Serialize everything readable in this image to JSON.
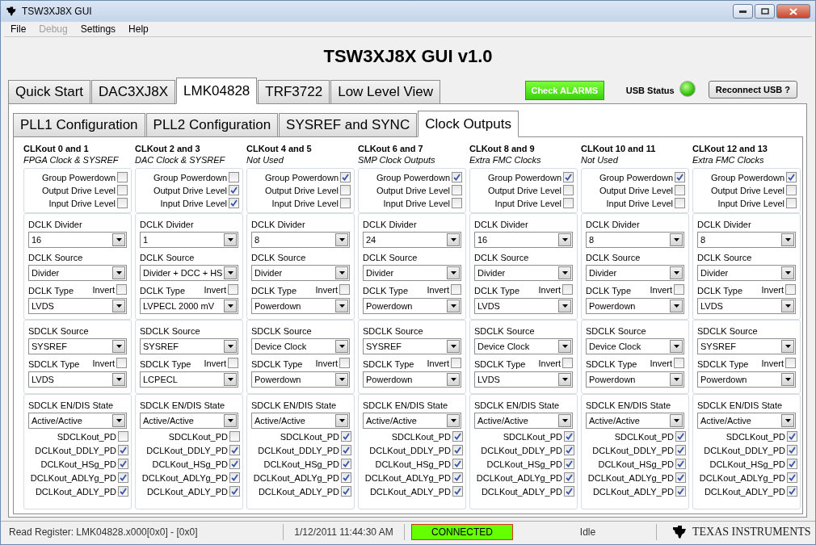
{
  "window": {
    "title": "TSW3XJ8X GUI"
  },
  "menu": [
    {
      "label": "File",
      "disabled": false
    },
    {
      "label": "Debug",
      "disabled": true
    },
    {
      "label": "Settings",
      "disabled": false
    },
    {
      "label": "Help",
      "disabled": false
    }
  ],
  "header": {
    "title": "TSW3XJ8X GUI v1.0"
  },
  "tabs": [
    {
      "label": "Quick Start",
      "selected": false
    },
    {
      "label": "DAC3XJ8X",
      "selected": false
    },
    {
      "label": "LMK04828",
      "selected": true
    },
    {
      "label": "TRF3722",
      "selected": false
    },
    {
      "label": "Low Level View",
      "selected": false
    }
  ],
  "alarm_button": "Check ALARMS",
  "usb_status": {
    "label": "USB Status",
    "on": true
  },
  "reconnect_button": "Reconnect USB ?",
  "subtabs": [
    {
      "label": "PLL1 Configuration",
      "selected": false
    },
    {
      "label": "PLL2 Configuration",
      "selected": false
    },
    {
      "label": "SYSREF and SYNC",
      "selected": false
    },
    {
      "label": "Clock Outputs",
      "selected": true
    }
  ],
  "columns": [
    {
      "title": "CLKout 0 and 1",
      "subtitle": "FPGA Clock & SYSREF",
      "groups": [
        {
          "items": [
            {
              "kind": "check",
              "label": "Group Powerdown",
              "checked": false
            },
            {
              "kind": "check",
              "label": "Output Drive Level",
              "checked": false
            },
            {
              "kind": "check",
              "label": "Input Drive Level",
              "checked": false
            }
          ]
        },
        {
          "items": [
            {
              "kind": "select",
              "label": "DCLK Divider",
              "value": "16"
            },
            {
              "kind": "select",
              "label": "DCLK Source",
              "value": "Divider"
            },
            {
              "kind": "select",
              "label": "DCLK Type",
              "value": "LVDS",
              "invert": {
                "label": "Invert",
                "checked": false
              }
            }
          ]
        },
        {
          "items": [
            {
              "kind": "select",
              "label": "SDCLK Source",
              "value": "SYSREF"
            },
            {
              "kind": "select",
              "label": "SDCLK Type",
              "value": "LVDS",
              "invert": {
                "label": "Invert",
                "checked": false
              }
            }
          ]
        },
        {
          "items": [
            {
              "kind": "select",
              "label": "SDCLK EN/DIS State",
              "value": "Active/Active"
            },
            {
              "kind": "check",
              "label": "SDCLKout_PD",
              "checked": false
            },
            {
              "kind": "check",
              "label": "DCLKout_DDLY_PD",
              "checked": true
            },
            {
              "kind": "check",
              "label": "DCLKout_HSg_PD",
              "checked": true
            },
            {
              "kind": "check",
              "label": "DCLKout_ADLYg_PD",
              "checked": true
            },
            {
              "kind": "check",
              "label": "DCLKout_ADLY_PD",
              "checked": true
            }
          ]
        }
      ]
    },
    {
      "title": "CLKout 2 and 3",
      "subtitle": "DAC Clock & SYSREF",
      "groups": [
        {
          "items": [
            {
              "kind": "check",
              "label": "Group Powerdown",
              "checked": false
            },
            {
              "kind": "check",
              "label": "Output Drive Level",
              "checked": true
            },
            {
              "kind": "check",
              "label": "Input Drive Level",
              "checked": true
            }
          ]
        },
        {
          "items": [
            {
              "kind": "select",
              "label": "DCLK Divider",
              "value": "1"
            },
            {
              "kind": "select",
              "label": "DCLK Source",
              "value": "Divider + DCC + HS"
            },
            {
              "kind": "select",
              "label": "DCLK Type",
              "value": "LVPECL 2000 mV",
              "invert": {
                "label": "Invert",
                "checked": false
              }
            }
          ]
        },
        {
          "items": [
            {
              "kind": "select",
              "label": "SDCLK Source",
              "value": "SYSREF"
            },
            {
              "kind": "select",
              "label": "SDCLK Type",
              "value": "LCPECL",
              "invert": {
                "label": "Invert",
                "checked": false
              }
            }
          ]
        },
        {
          "items": [
            {
              "kind": "select",
              "label": "SDCLK EN/DIS State",
              "value": "Active/Active"
            },
            {
              "kind": "check",
              "label": "SDCLKout_PD",
              "checked": false
            },
            {
              "kind": "check",
              "label": "DCLKout_DDLY_PD",
              "checked": true
            },
            {
              "kind": "check",
              "label": "DCLKout_HSg_PD",
              "checked": true
            },
            {
              "kind": "check",
              "label": "DCLKout_ADLYg_PD",
              "checked": true
            },
            {
              "kind": "check",
              "label": "DCLKout_ADLY_PD",
              "checked": true
            }
          ]
        }
      ]
    },
    {
      "title": "CLKout 4 and 5",
      "subtitle": "Not Used",
      "groups": [
        {
          "items": [
            {
              "kind": "check",
              "label": "Group Powerdown",
              "checked": true
            },
            {
              "kind": "check",
              "label": "Output Drive Level",
              "checked": false
            },
            {
              "kind": "check",
              "label": "Input Drive Level",
              "checked": false
            }
          ]
        },
        {
          "items": [
            {
              "kind": "select",
              "label": "DCLK Divider",
              "value": "8"
            },
            {
              "kind": "select",
              "label": "DCLK Source",
              "value": "Divider"
            },
            {
              "kind": "select",
              "label": "DCLK Type",
              "value": "Powerdown",
              "invert": {
                "label": "Invert",
                "checked": false
              }
            }
          ]
        },
        {
          "items": [
            {
              "kind": "select",
              "label": "SDCLK Source",
              "value": "Device Clock"
            },
            {
              "kind": "select",
              "label": "SDCLK Type",
              "value": "Powerdown",
              "invert": {
                "label": "Invert",
                "checked": false
              }
            }
          ]
        },
        {
          "items": [
            {
              "kind": "select",
              "label": "SDCLK EN/DIS State",
              "value": "Active/Active"
            },
            {
              "kind": "check",
              "label": "SDCLKout_PD",
              "checked": true
            },
            {
              "kind": "check",
              "label": "DCLKout_DDLY_PD",
              "checked": true
            },
            {
              "kind": "check",
              "label": "DCLKout_HSg_PD",
              "checked": true
            },
            {
              "kind": "check",
              "label": "DCLKout_ADLYg_PD",
              "checked": true
            },
            {
              "kind": "check",
              "label": "DCLKout_ADLY_PD",
              "checked": true
            }
          ]
        }
      ]
    },
    {
      "title": "CLKout 6 and 7",
      "subtitle": "SMP Clock Outputs",
      "groups": [
        {
          "items": [
            {
              "kind": "check",
              "label": "Group Powerdown",
              "checked": true
            },
            {
              "kind": "check",
              "label": "Output Drive Level",
              "checked": false
            },
            {
              "kind": "check",
              "label": "Input Drive Level",
              "checked": false
            }
          ]
        },
        {
          "items": [
            {
              "kind": "select",
              "label": "DCLK Divider",
              "value": "24"
            },
            {
              "kind": "select",
              "label": "DCLK Source",
              "value": "Divider"
            },
            {
              "kind": "select",
              "label": "DCLK Type",
              "value": "Powerdown",
              "invert": {
                "label": "Invert",
                "checked": false
              }
            }
          ]
        },
        {
          "items": [
            {
              "kind": "select",
              "label": "SDCLK Source",
              "value": "SYSREF"
            },
            {
              "kind": "select",
              "label": "SDCLK Type",
              "value": "Powerdown",
              "invert": {
                "label": "Invert",
                "checked": false
              }
            }
          ]
        },
        {
          "items": [
            {
              "kind": "select",
              "label": "SDCLK EN/DIS State",
              "value": "Active/Active"
            },
            {
              "kind": "check",
              "label": "SDCLKout_PD",
              "checked": true
            },
            {
              "kind": "check",
              "label": "DCLKout_DDLY_PD",
              "checked": true
            },
            {
              "kind": "check",
              "label": "DCLKout_HSg_PD",
              "checked": true
            },
            {
              "kind": "check",
              "label": "DCLKout_ADLYg_PD",
              "checked": true
            },
            {
              "kind": "check",
              "label": "DCLKout_ADLY_PD",
              "checked": true
            }
          ]
        }
      ]
    },
    {
      "title": "CLKout 8 and 9",
      "subtitle": "Extra FMC Clocks",
      "groups": [
        {
          "items": [
            {
              "kind": "check",
              "label": "Group Powerdown",
              "checked": true
            },
            {
              "kind": "check",
              "label": "Output Drive Level",
              "checked": false
            },
            {
              "kind": "check",
              "label": "Input Drive Level",
              "checked": false
            }
          ]
        },
        {
          "items": [
            {
              "kind": "select",
              "label": "DCLK Divider",
              "value": "16"
            },
            {
              "kind": "select",
              "label": "DCLK Source",
              "value": "Divider"
            },
            {
              "kind": "select",
              "label": "DCLK Type",
              "value": "LVDS",
              "invert": {
                "label": "Invert",
                "checked": false
              }
            }
          ]
        },
        {
          "items": [
            {
              "kind": "select",
              "label": "SDCLK Source",
              "value": "Device Clock"
            },
            {
              "kind": "select",
              "label": "SDCLK Type",
              "value": "LVDS",
              "invert": {
                "label": "Invert",
                "checked": false
              }
            }
          ]
        },
        {
          "items": [
            {
              "kind": "select",
              "label": "SDCLK EN/DIS State",
              "value": "Active/Active"
            },
            {
              "kind": "check",
              "label": "SDCLKout_PD",
              "checked": true
            },
            {
              "kind": "check",
              "label": "DCLKout_DDLY_PD",
              "checked": true
            },
            {
              "kind": "check",
              "label": "DCLKout_HSg_PD",
              "checked": true
            },
            {
              "kind": "check",
              "label": "DCLKout_ADLYg_PD",
              "checked": true
            },
            {
              "kind": "check",
              "label": "DCLKout_ADLY_PD",
              "checked": true
            }
          ]
        }
      ]
    },
    {
      "title": "CLKout 10 and 11",
      "subtitle": "Not Used",
      "groups": [
        {
          "items": [
            {
              "kind": "check",
              "label": "Group Powerdown",
              "checked": true
            },
            {
              "kind": "check",
              "label": "Output Drive Level",
              "checked": false
            },
            {
              "kind": "check",
              "label": "Input Drive Level",
              "checked": false
            }
          ]
        },
        {
          "items": [
            {
              "kind": "select",
              "label": "DCLK Divider",
              "value": "8"
            },
            {
              "kind": "select",
              "label": "DCLK Source",
              "value": "Divider"
            },
            {
              "kind": "select",
              "label": "DCLK Type",
              "value": "Powerdown",
              "invert": {
                "label": "Invert",
                "checked": false
              }
            }
          ]
        },
        {
          "items": [
            {
              "kind": "select",
              "label": "SDCLK Source",
              "value": "Device Clock"
            },
            {
              "kind": "select",
              "label": "SDCLK Type",
              "value": "Powerdown",
              "invert": {
                "label": "Invert",
                "checked": false
              }
            }
          ]
        },
        {
          "items": [
            {
              "kind": "select",
              "label": "SDCLK EN/DIS State",
              "value": "Active/Active"
            },
            {
              "kind": "check",
              "label": "SDCLKout_PD",
              "checked": true
            },
            {
              "kind": "check",
              "label": "DCLKout_DDLY_PD",
              "checked": true
            },
            {
              "kind": "check",
              "label": "DCLKout_HSg_PD",
              "checked": true
            },
            {
              "kind": "check",
              "label": "DCLKout_ADLYg_PD",
              "checked": true
            },
            {
              "kind": "check",
              "label": "DCLKout_ADLY_PD",
              "checked": true
            }
          ]
        }
      ]
    },
    {
      "title": "CLKout 12 and 13",
      "subtitle": "Extra FMC Clocks",
      "groups": [
        {
          "items": [
            {
              "kind": "check",
              "label": "Group Powerdown",
              "checked": true
            },
            {
              "kind": "check",
              "label": "Output Drive Level",
              "checked": false
            },
            {
              "kind": "check",
              "label": "Input Drive Level",
              "checked": false
            }
          ]
        },
        {
          "items": [
            {
              "kind": "select",
              "label": "DCLK Divider",
              "value": "8"
            },
            {
              "kind": "select",
              "label": "DCLK Source",
              "value": "Divider"
            },
            {
              "kind": "select",
              "label": "DCLK Type",
              "value": "LVDS",
              "invert": {
                "label": "Invert",
                "checked": false
              }
            }
          ]
        },
        {
          "items": [
            {
              "kind": "select",
              "label": "SDCLK Source",
              "value": "SYSREF"
            },
            {
              "kind": "select",
              "label": "SDCLK Type",
              "value": "Powerdown",
              "invert": {
                "label": "Invert",
                "checked": false
              }
            }
          ]
        },
        {
          "items": [
            {
              "kind": "select",
              "label": "SDCLK EN/DIS State",
              "value": "Active/Active"
            },
            {
              "kind": "check",
              "label": "SDCLKout_PD",
              "checked": true
            },
            {
              "kind": "check",
              "label": "DCLKout_DDLY_PD",
              "checked": true
            },
            {
              "kind": "check",
              "label": "DCLKout_HSg_PD",
              "checked": true
            },
            {
              "kind": "check",
              "label": "DCLKout_ADLYg_PD",
              "checked": true
            },
            {
              "kind": "check",
              "label": "DCLKout_ADLY_PD",
              "checked": true
            }
          ]
        }
      ]
    }
  ],
  "status_bar": {
    "register": "Read Register: LMK04828.x000[0x0] - [0x0]",
    "datetime": "1/12/2011 11:44:30 AM",
    "connection": {
      "label": "CONNECTED",
      "connected": true
    },
    "state": "Idle",
    "brand": "TEXAS INSTRUMENTS"
  }
}
